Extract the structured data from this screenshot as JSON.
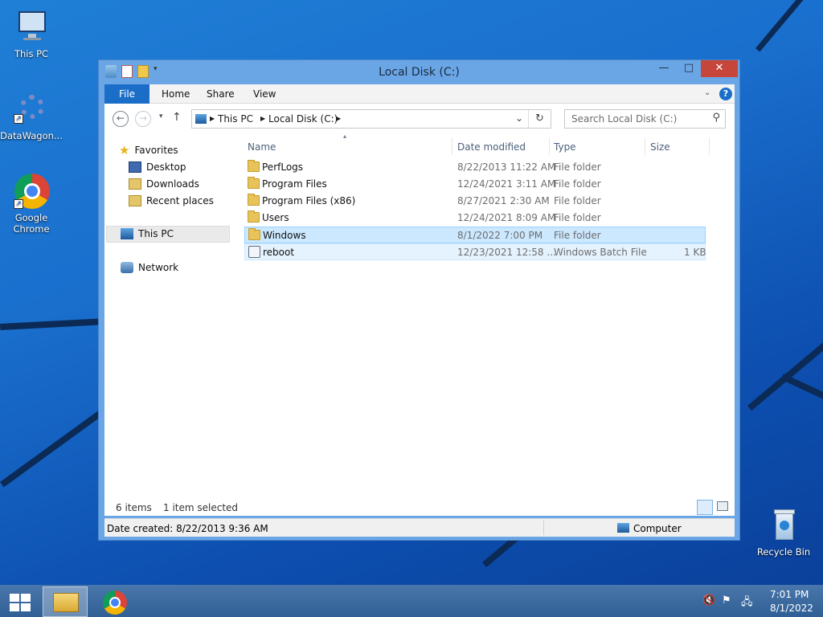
{
  "desktop": {
    "icons": [
      {
        "label": "This PC",
        "icon": "this-pc-icon"
      },
      {
        "label": "DataWagon...",
        "icon": "datawagon-icon"
      },
      {
        "label": "Google Chrome",
        "icon": "chrome-icon"
      },
      {
        "label": "Recycle Bin",
        "icon": "recycle-bin-icon"
      }
    ]
  },
  "window": {
    "title": "Local Disk (C:)",
    "controls": {
      "minimize": "—",
      "maximize": "□",
      "close": "✕"
    },
    "ribbon_tabs": [
      "File",
      "Home",
      "Share",
      "View"
    ],
    "breadcrumb": [
      "This PC",
      "Local Disk (C:)"
    ],
    "search_placeholder": "Search Local Disk (C:)",
    "nav": {
      "favorites": "Favorites",
      "desktop": "Desktop",
      "downloads": "Downloads",
      "recent": "Recent places",
      "this_pc": "This PC",
      "network": "Network"
    },
    "columns": [
      "Name",
      "Date modified",
      "Type",
      "Size"
    ],
    "files": [
      {
        "name": "PerfLogs",
        "date": "8/22/2013 11:22 AM",
        "type": "File folder",
        "size": ""
      },
      {
        "name": "Program Files",
        "date": "12/24/2021 3:11 AM",
        "type": "File folder",
        "size": ""
      },
      {
        "name": "Program Files (x86)",
        "date": "8/27/2021 2:30 AM",
        "type": "File folder",
        "size": ""
      },
      {
        "name": "Users",
        "date": "12/24/2021 8:09 AM",
        "type": "File folder",
        "size": ""
      },
      {
        "name": "Windows",
        "date": "8/1/2022 7:00 PM",
        "type": "File folder",
        "size": ""
      },
      {
        "name": "reboot",
        "date": "12/23/2021 12:58 ...",
        "type": "Windows Batch File",
        "size": "1 KB"
      }
    ],
    "status": {
      "items": "6 items",
      "selected": "1 item selected"
    },
    "details": {
      "created": "Date created: 8/22/2013 9:36 AM",
      "location": "Computer"
    }
  },
  "taskbar": {
    "time": "7:01 PM",
    "date": "8/1/2022"
  },
  "colors": {
    "accent": "#1a6ec7",
    "selection": "#cce8ff",
    "close": "#c7463c"
  }
}
